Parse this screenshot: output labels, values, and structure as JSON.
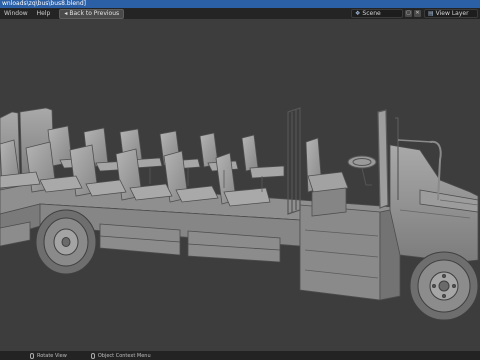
{
  "window": {
    "title": "wnloads\\zq\\bus\\bus8.blend]"
  },
  "menubar": {
    "items": [
      "Window",
      "Help"
    ],
    "back_button": "Back to Previous",
    "scene_label": "Scene",
    "view_layer_label": "View Layer"
  },
  "statusbar": {
    "items": [
      "Rotate View",
      "Object Context Menu"
    ]
  },
  "icons": {
    "back": "back-arrow-icon",
    "scene": "scene-icon",
    "view_layer": "view-layer-icon",
    "mouse": "mouse-icon"
  },
  "colors": {
    "titlebar": "#2b5fa6",
    "viewport": "#3d3d3d",
    "model": "#9b9b9b"
  }
}
